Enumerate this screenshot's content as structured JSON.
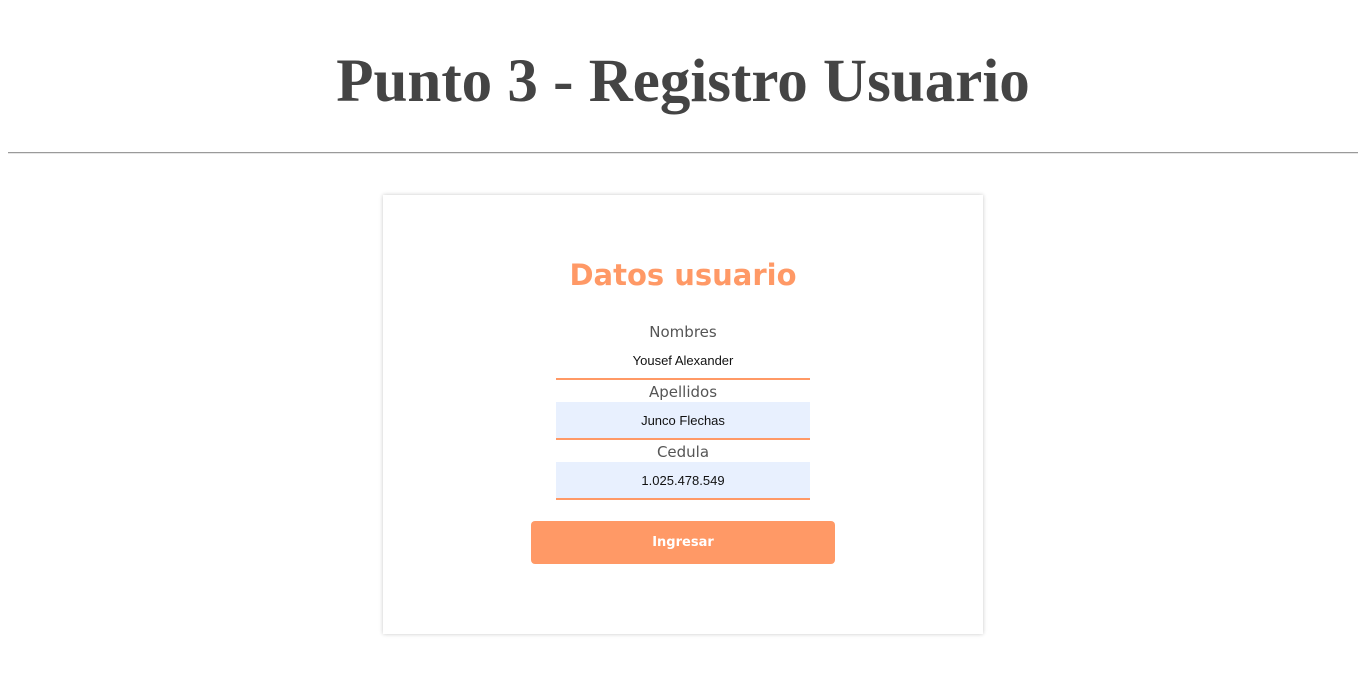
{
  "page": {
    "title": "Punto 3 - Registro Usuario"
  },
  "form": {
    "heading": "Datos usuario",
    "fields": [
      {
        "label": "Nombres",
        "value": "Yousef Alexander"
      },
      {
        "label": "Apellidos",
        "value": "Junco Flechas"
      },
      {
        "label": "Cedula",
        "value": "1.025.478.549"
      }
    ],
    "submit_label": "Ingresar"
  },
  "colors": {
    "accent": "#ff9966",
    "title_text": "#444444",
    "autofill_background": "#e8f0fe"
  }
}
